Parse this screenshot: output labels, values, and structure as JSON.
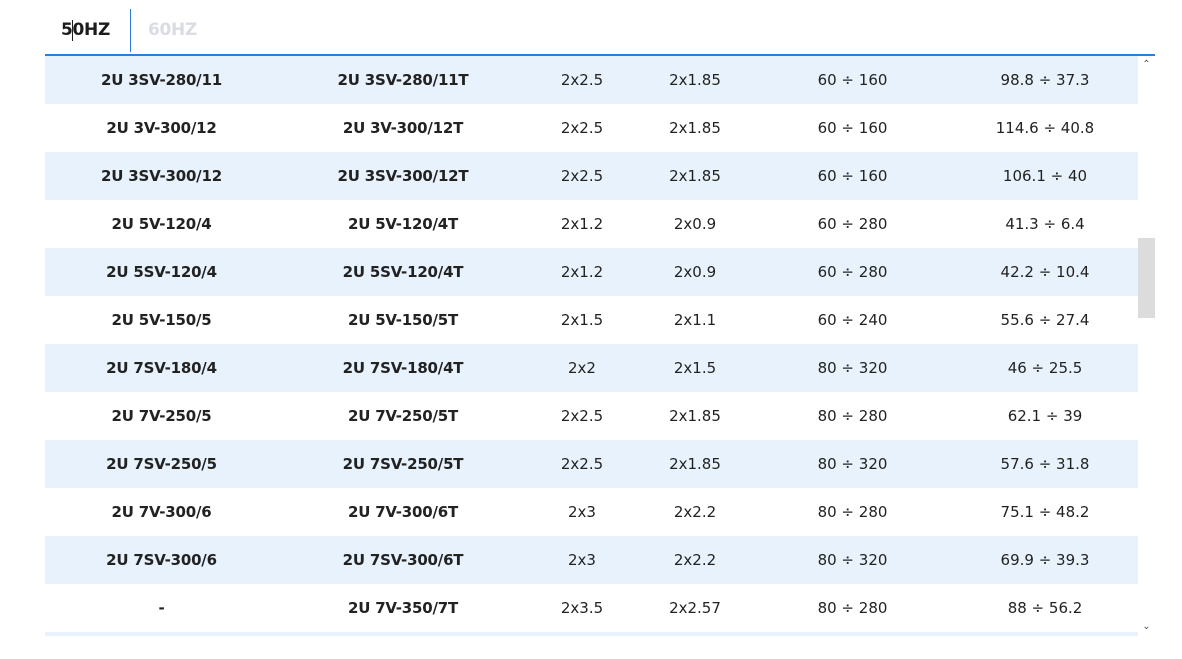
{
  "tabs": {
    "hz50": "50HZ",
    "hz60": "60HZ",
    "active": "50HZ"
  },
  "table": {
    "rows": [
      [
        "2U 3SV-280/11",
        "2U 3SV-280/11T",
        "2x2.5",
        "2x1.85",
        "60 ÷ 160",
        "98.8 ÷ 37.3"
      ],
      [
        "2U 3V-300/12",
        "2U 3V-300/12T",
        "2x2.5",
        "2x1.85",
        "60 ÷ 160",
        "114.6 ÷ 40.8"
      ],
      [
        "2U 3SV-300/12",
        "2U 3SV-300/12T",
        "2x2.5",
        "2x1.85",
        "60 ÷ 160",
        "106.1 ÷ 40"
      ],
      [
        "2U 5V-120/4",
        "2U 5V-120/4T",
        "2x1.2",
        "2x0.9",
        "60 ÷ 280",
        "41.3 ÷ 6.4"
      ],
      [
        "2U 5SV-120/4",
        "2U 5SV-120/4T",
        "2x1.2",
        "2x0.9",
        "60 ÷ 280",
        "42.2 ÷ 10.4"
      ],
      [
        "2U 5V-150/5",
        "2U 5V-150/5T",
        "2x1.5",
        "2x1.1",
        "60 ÷ 240",
        "55.6 ÷ 27.4"
      ],
      [
        "2U 7SV-180/4",
        "2U 7SV-180/4T",
        "2x2",
        "2x1.5",
        "80 ÷ 320",
        "46 ÷ 25.5"
      ],
      [
        "2U 7V-250/5",
        "2U 7V-250/5T",
        "2x2.5",
        "2x1.85",
        "80 ÷ 280",
        "62.1 ÷ 39"
      ],
      [
        "2U 7SV-250/5",
        "2U 7SV-250/5T",
        "2x2.5",
        "2x1.85",
        "80 ÷ 320",
        "57.6 ÷ 31.8"
      ],
      [
        "2U 7V-300/6",
        "2U 7V-300/6T",
        "2x3",
        "2x2.2",
        "80 ÷ 280",
        "75.1 ÷ 48.2"
      ],
      [
        "2U 7SV-300/6",
        "2U 7SV-300/6T",
        "2x3",
        "2x2.2",
        "80 ÷ 320",
        "69.9 ÷ 39.3"
      ],
      [
        "-",
        "2U 7V-350/7T",
        "2x3.5",
        "2x2.57",
        "80 ÷ 280",
        "88 ÷ 56.2"
      ],
      [
        "",
        "",
        "",
        "",
        "",
        ""
      ]
    ]
  },
  "scrollbar": {
    "up_icon": "chevron-up-icon",
    "down_icon": "chevron-down-icon",
    "up_glyph": "⌃",
    "down_glyph": "⌄"
  },
  "colors": {
    "accent": "#2c7fd6",
    "row_stripe": "#e8f2fd",
    "inactive_tab": "#d9dde3"
  }
}
